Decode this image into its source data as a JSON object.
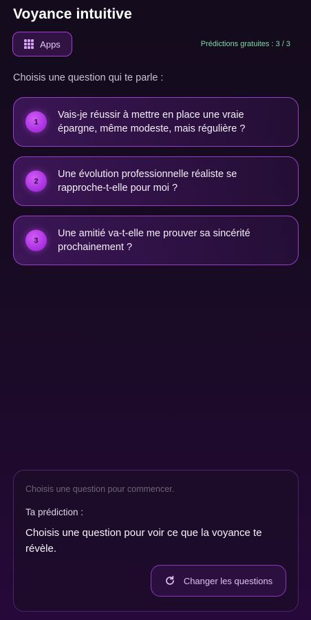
{
  "header": {
    "title": "Voyance intuitive",
    "apps_label": "Apps",
    "free_predictions": "Prédictions gratuites : 3 / 3"
  },
  "prompt": "Choisis une question qui te parle :",
  "questions": [
    {
      "number": "1",
      "text": "Vais-je réussir à mettre en place une vraie épargne, même modeste, mais régulière ?"
    },
    {
      "number": "2",
      "text": "Une évolution professionnelle réaliste se rapproche-t-elle pour moi ?"
    },
    {
      "number": "3",
      "text": "Une amitié va-t-elle me prouver sa sincérité prochainement ?"
    }
  ],
  "result": {
    "status": "Choisis une question pour commencer.",
    "label": "Ta prédiction :",
    "text": "Choisis une question pour voir ce que la voyance te révèle.",
    "change_label": "Changer les questions"
  },
  "icons": {
    "apps": "grid-icon",
    "change": "refresh-icon"
  },
  "colors": {
    "accent": "#a13fd6",
    "free_count": "#7fd8a8"
  }
}
